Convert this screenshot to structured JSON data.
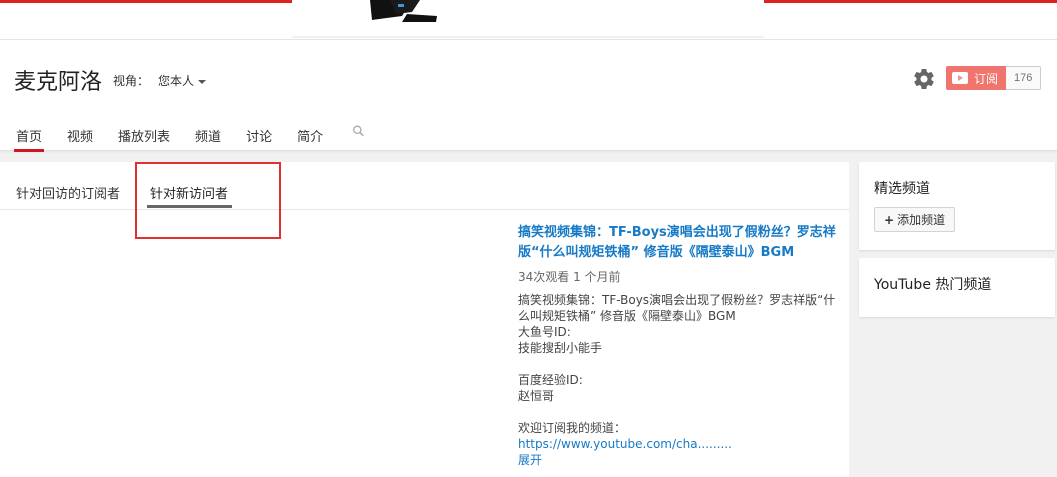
{
  "channel": {
    "title": "麦克阿洛",
    "view_as_label": "视角：",
    "view_as_value": "您本人",
    "subscribe_label": "订阅",
    "subscriber_count": "176"
  },
  "tabs": [
    {
      "label": "首页",
      "active": true
    },
    {
      "label": "视频"
    },
    {
      "label": "播放列表"
    },
    {
      "label": "频道"
    },
    {
      "label": "讨论"
    },
    {
      "label": "简介"
    }
  ],
  "subtabs": {
    "returning": "针对回访的订阅者",
    "new_visitors": "针对新访问者"
  },
  "video": {
    "title": "搞笑视频集锦：TF-Boys演唱会出现了假粉丝？罗志祥版“什么叫规矩铁桶” 修音版《隔壁泰山》BGM",
    "meta": "34次观看  1 个月前",
    "description": "搞笑视频集锦：TF-Boys演唱会出现了假粉丝？罗志祥版“什么叫规矩铁桶” 修音版《隔壁泰山》BGM\n大鱼号ID:\n技能搜刮小能手\n\n百度经验ID:\n赵恒哥\n\n欢迎订阅我的频道：",
    "link": "https://www.youtube.com/cha.........",
    "expand": "展开"
  },
  "sidebar": {
    "featured_title": "精选频道",
    "add_channel": "添加频道",
    "popular_title": "YouTube 热门频道"
  },
  "colors": {
    "accent_red": "#cc181e",
    "link_blue": "#167ac6",
    "highlight_box": "#e03131"
  },
  "icons": [
    "gear-icon",
    "search-icon",
    "play-icon",
    "caret-down-icon"
  ]
}
